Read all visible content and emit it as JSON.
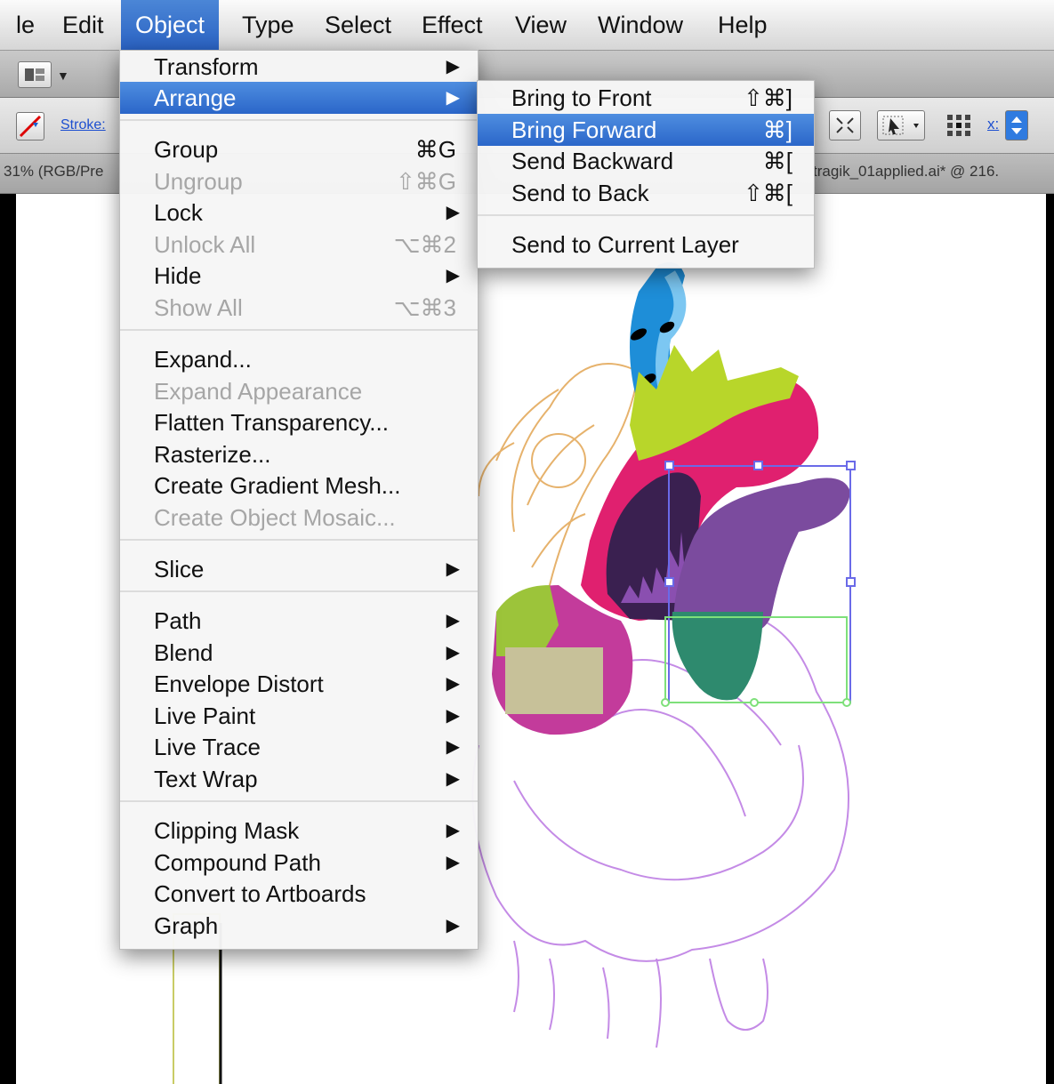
{
  "menubar": {
    "items": [
      "le",
      "Edit",
      "Object",
      "Type",
      "Select",
      "Effect",
      "View",
      "Window",
      "Help"
    ]
  },
  "control_bar": {
    "stroke_label": "Stroke:",
    "x_label": "x:"
  },
  "doc_tabs": {
    "left_tab": "31% (RGB/Pre",
    "right_tab": "tragik_01applied.ai* @ 216."
  },
  "object_menu": {
    "items": [
      {
        "label": "Transform",
        "shortcut": "",
        "submenu": true,
        "disabled": false
      },
      {
        "label": "Arrange",
        "shortcut": "",
        "submenu": true,
        "disabled": false
      },
      {
        "label": "Group",
        "shortcut": "⌘G",
        "submenu": false,
        "disabled": false
      },
      {
        "label": "Ungroup",
        "shortcut": "⇧⌘G",
        "submenu": false,
        "disabled": true
      },
      {
        "label": "Lock",
        "shortcut": "",
        "submenu": true,
        "disabled": false
      },
      {
        "label": "Unlock All",
        "shortcut": "⌥⌘2",
        "submenu": false,
        "disabled": true
      },
      {
        "label": "Hide",
        "shortcut": "",
        "submenu": true,
        "disabled": false
      },
      {
        "label": "Show All",
        "shortcut": "⌥⌘3",
        "submenu": false,
        "disabled": true
      },
      {
        "label": "Expand...",
        "shortcut": "",
        "submenu": false,
        "disabled": false
      },
      {
        "label": "Expand Appearance",
        "shortcut": "",
        "submenu": false,
        "disabled": true
      },
      {
        "label": "Flatten Transparency...",
        "shortcut": "",
        "submenu": false,
        "disabled": false
      },
      {
        "label": "Rasterize...",
        "shortcut": "",
        "submenu": false,
        "disabled": false
      },
      {
        "label": "Create Gradient Mesh...",
        "shortcut": "",
        "submenu": false,
        "disabled": false
      },
      {
        "label": "Create Object Mosaic...",
        "shortcut": "",
        "submenu": false,
        "disabled": true
      },
      {
        "label": "Slice",
        "shortcut": "",
        "submenu": true,
        "disabled": false
      },
      {
        "label": "Path",
        "shortcut": "",
        "submenu": true,
        "disabled": false
      },
      {
        "label": "Blend",
        "shortcut": "",
        "submenu": true,
        "disabled": false
      },
      {
        "label": "Envelope Distort",
        "shortcut": "",
        "submenu": true,
        "disabled": false
      },
      {
        "label": "Live Paint",
        "shortcut": "",
        "submenu": true,
        "disabled": false
      },
      {
        "label": "Live Trace",
        "shortcut": "",
        "submenu": true,
        "disabled": false
      },
      {
        "label": "Text Wrap",
        "shortcut": "",
        "submenu": true,
        "disabled": false
      },
      {
        "label": "Clipping Mask",
        "shortcut": "",
        "submenu": true,
        "disabled": false
      },
      {
        "label": "Compound Path",
        "shortcut": "",
        "submenu": true,
        "disabled": false
      },
      {
        "label": "Convert to Artboards",
        "shortcut": "",
        "submenu": false,
        "disabled": false
      },
      {
        "label": "Graph",
        "shortcut": "",
        "submenu": true,
        "disabled": false
      }
    ]
  },
  "arrange_menu": {
    "items": [
      {
        "label": "Bring to Front",
        "shortcut": "⇧⌘]"
      },
      {
        "label": "Bring Forward",
        "shortcut": "⌘]"
      },
      {
        "label": "Send Backward",
        "shortcut": "⌘["
      },
      {
        "label": "Send to Back",
        "shortcut": "⇧⌘["
      },
      {
        "label": "Send to Current Layer",
        "shortcut": ""
      }
    ]
  },
  "colors": {
    "highlight": "#2f6bd0",
    "heart_pink": "#e0206f",
    "heart_purple": "#7b4b9e",
    "heart_teal": "#2e8a6e",
    "heart_blue": "#1e8ed8",
    "heart_lime": "#b8d62a",
    "outline_purple": "#c48be6",
    "outline_orange": "#e6b26c"
  }
}
